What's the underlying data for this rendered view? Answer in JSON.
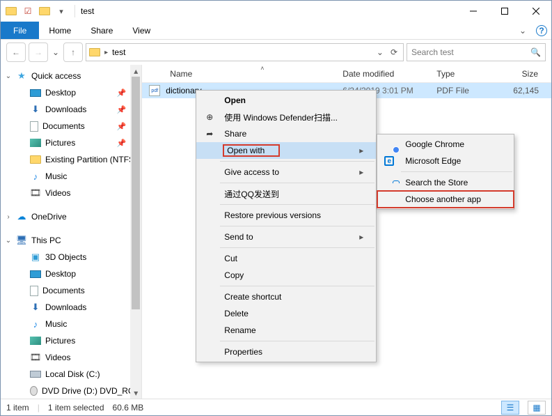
{
  "titlebar": {
    "title": "test"
  },
  "ribbon": {
    "file": "File",
    "home": "Home",
    "share": "Share",
    "view": "View"
  },
  "address": {
    "crumb": "test"
  },
  "search": {
    "placeholder": "Search test"
  },
  "sidebar": {
    "quick_access": "Quick access",
    "desktop": "Desktop",
    "downloads": "Downloads",
    "documents": "Documents",
    "pictures": "Pictures",
    "existing_partition": "Existing Partition (NTFS)",
    "music": "Music",
    "videos": "Videos",
    "onedrive": "OneDrive",
    "this_pc": "This PC",
    "threed": "3D Objects",
    "desktop2": "Desktop",
    "documents2": "Documents",
    "downloads2": "Downloads",
    "music2": "Music",
    "pictures2": "Pictures",
    "videos2": "Videos",
    "local_disk": "Local Disk (C:)",
    "dvd": "DVD Drive (D:) DVD_ROM"
  },
  "columns": {
    "name": "Name",
    "date": "Date modified",
    "type": "Type",
    "size": "Size"
  },
  "file": {
    "name": "dictionary",
    "date": "6/24/2019 3:01 PM",
    "type": "PDF File",
    "size": "62,145"
  },
  "ctx": {
    "open": "Open",
    "defender": "使用 Windows Defender扫描...",
    "share": "Share",
    "open_with": "Open with",
    "give_access": "Give access to",
    "qq": "通过QQ发送到",
    "restore": "Restore previous versions",
    "send_to": "Send to",
    "cut": "Cut",
    "copy": "Copy",
    "shortcut": "Create shortcut",
    "delete": "Delete",
    "rename": "Rename",
    "properties": "Properties"
  },
  "submenu": {
    "chrome": "Google Chrome",
    "edge": "Microsoft Edge",
    "store": "Search the Store",
    "choose": "Choose another app"
  },
  "status": {
    "items": "1 item",
    "selected": "1 item selected",
    "size": "60.6 MB"
  }
}
